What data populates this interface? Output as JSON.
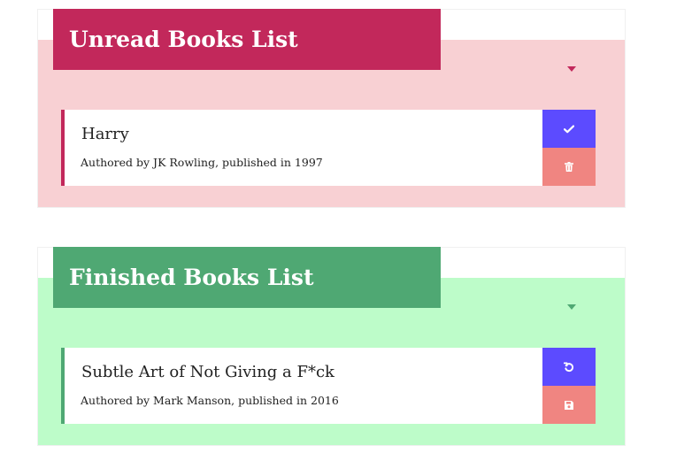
{
  "unread": {
    "title": "Unread Books List",
    "colors": {
      "panel_bg": "#f8d0d3",
      "header_bg": "#c2285b",
      "accent": "#c2285b"
    },
    "books": [
      {
        "title": "Harry",
        "meta": "Authored by JK Rowling, published in 1997",
        "primary_action_icon": "check-icon",
        "secondary_action_icon": "trash-icon"
      }
    ]
  },
  "finished": {
    "title": "Finished Books List",
    "colors": {
      "panel_bg": "#bdfcc9",
      "header_bg": "#4fa873",
      "accent": "#4fa873"
    },
    "books": [
      {
        "title": "Subtle Art of Not Giving a F*ck",
        "meta": "Authored by Mark Manson, published in 2016",
        "primary_action_icon": "undo-icon",
        "secondary_action_icon": "save-icon"
      }
    ]
  },
  "button_colors": {
    "primary": "#5c4bff",
    "secondary": "#f08581"
  }
}
